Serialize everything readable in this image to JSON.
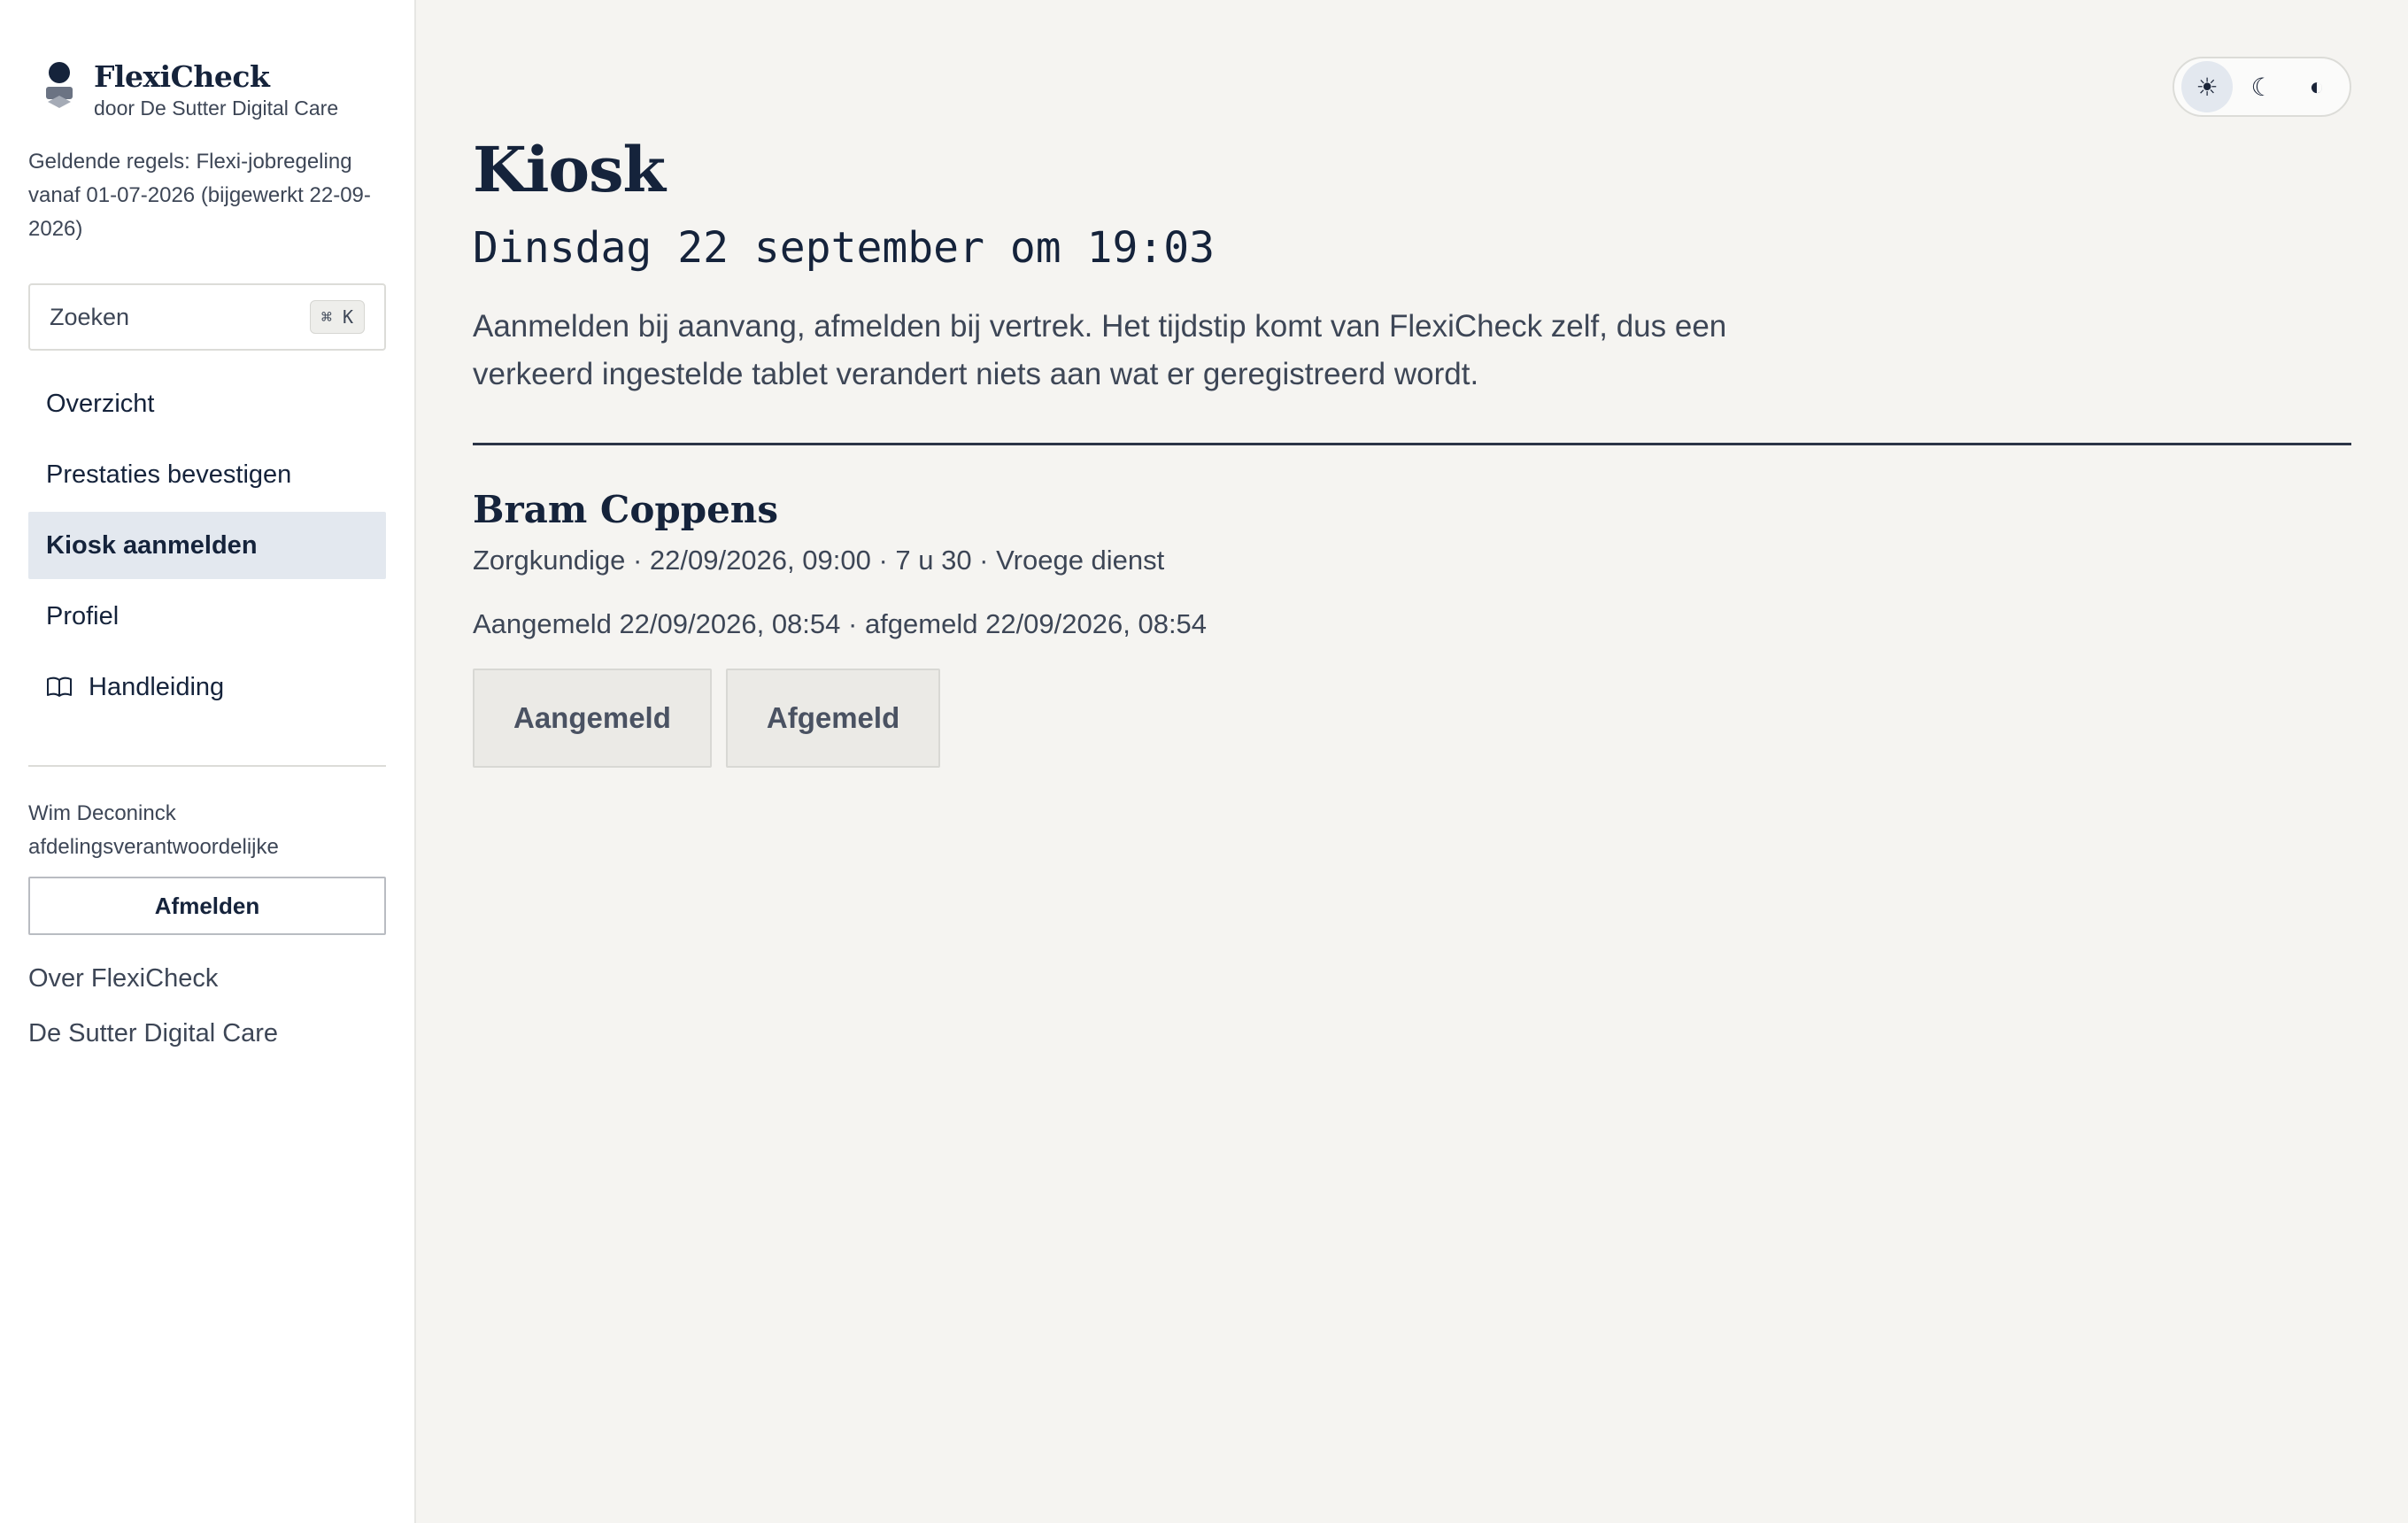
{
  "brand": {
    "name": "FlexiCheck",
    "subtitle": "door De Sutter Digital Care"
  },
  "sidebar": {
    "rules_text": "Geldende regels: Flexi-jobregeling vanaf 01-07-2026 (bijgewerkt 22-09-2026)",
    "search": {
      "placeholder": "Zoeken",
      "shortcut": "⌘ K"
    },
    "nav": [
      {
        "label": "Overzicht",
        "active": false
      },
      {
        "label": "Prestaties bevestigen",
        "active": false
      },
      {
        "label": "Kiosk aanmelden",
        "active": true
      },
      {
        "label": "Profiel",
        "active": false
      },
      {
        "label": "Handleiding",
        "active": false,
        "icon": "book-icon"
      }
    ],
    "user": {
      "name": "Wim Deconinck",
      "role": "afdelingsverantwoordelijke"
    },
    "logout_label": "Afmelden",
    "footer_links": [
      "Over FlexiCheck",
      "De Sutter Digital Care"
    ]
  },
  "theme_toggle": {
    "options": [
      {
        "icon": "sun-icon",
        "glyph": "☀",
        "active": true
      },
      {
        "icon": "moon-icon",
        "glyph": "☾",
        "active": false
      },
      {
        "icon": "contrast-icon",
        "glyph": "◐",
        "active": false
      }
    ]
  },
  "main": {
    "title": "Kiosk",
    "datetime": "Dinsdag 22 september om 19:03",
    "intro": "Aanmelden bij aanvang, afmelden bij vertrek. Het tijdstip komt van FlexiCheck zelf, dus een verkeerd ingestelde tablet verandert niets aan wat er geregistreerd wordt.",
    "entry": {
      "name": "Bram Coppens",
      "shift": "Zorgkundige · 22/09/2026, 09:00 · 7 u 30 · Vroege dienst",
      "status": "Aangemeld 22/09/2026, 08:54 · afgemeld 22/09/2026, 08:54",
      "buttons": {
        "checkin": "Aangemeld",
        "checkout": "Afgemeld"
      }
    }
  },
  "colors": {
    "primary": "#15233b",
    "text_muted": "#3d4656",
    "background": "#f5f4f1",
    "nav_active": "#e3e8ef"
  }
}
